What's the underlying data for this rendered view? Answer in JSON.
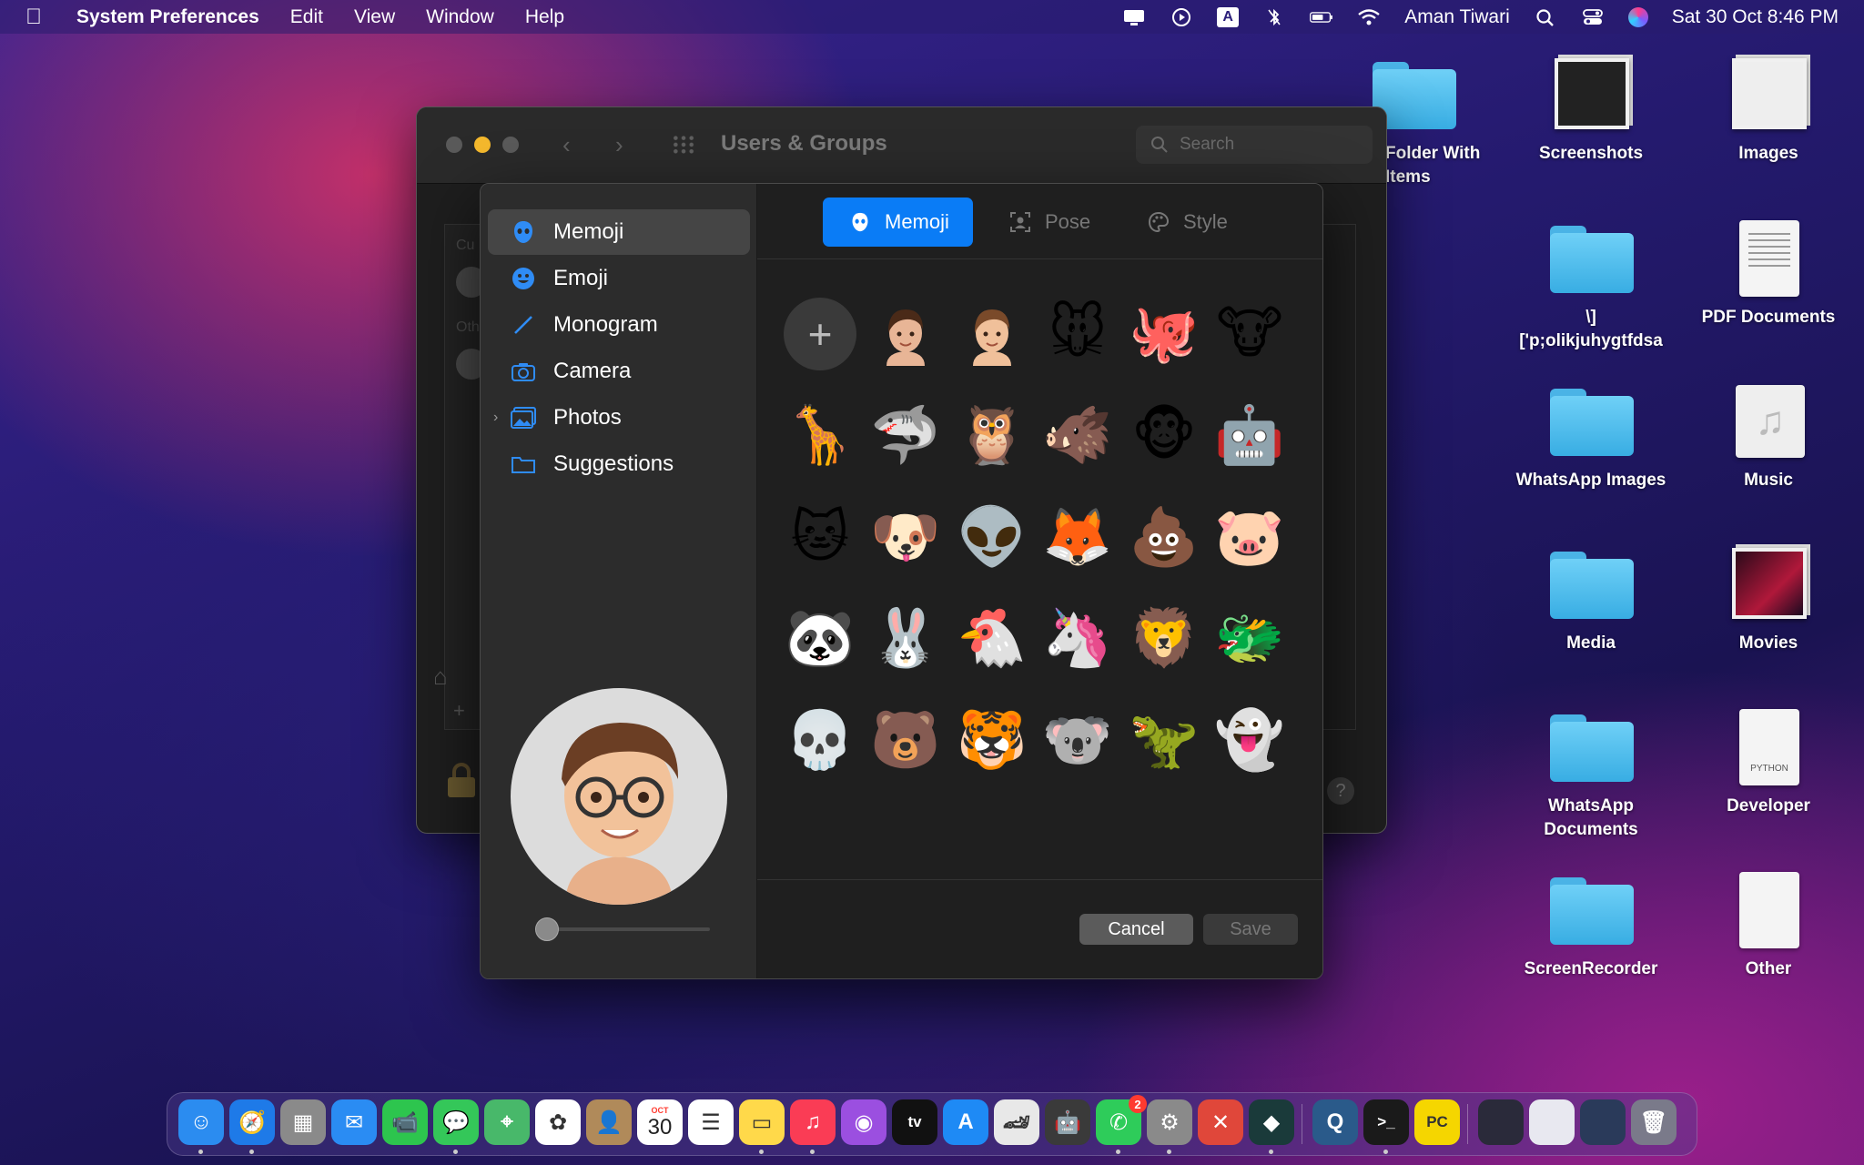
{
  "menubar": {
    "app_name": "System Preferences",
    "menus": [
      "Edit",
      "View",
      "Window",
      "Help"
    ],
    "user": "Aman Tiwari",
    "datetime": "Sat 30 Oct  8:46 PM",
    "input_source": "A"
  },
  "desktop": {
    "items": [
      {
        "label": "Folder With\nItems",
        "kind": "folder"
      },
      {
        "label": "Screenshots",
        "kind": "stack"
      },
      {
        "label": "Images",
        "kind": "stack-doc"
      },
      {
        "label": "\\]\n['p;olikjuhygtfdsa",
        "kind": "folder"
      },
      {
        "label": "PDF Documents",
        "kind": "doc"
      },
      {
        "label": "WhatsApp Images",
        "kind": "folder"
      },
      {
        "label": "Music",
        "kind": "music"
      },
      {
        "label": "Media",
        "kind": "folder"
      },
      {
        "label": "Movies",
        "kind": "stack-movies"
      },
      {
        "label": "WhatsApp\nDocuments",
        "kind": "folder"
      },
      {
        "label": "Developer",
        "kind": "doc-python"
      },
      {
        "label": "ScreenRecorder",
        "kind": "folder"
      },
      {
        "label": "Other",
        "kind": "doc-blank"
      }
    ],
    "python_label": "PYTHON"
  },
  "window": {
    "title": "Users & Groups",
    "search_placeholder": "Search",
    "list_labels": [
      "Cu",
      "Oth"
    ]
  },
  "sheet": {
    "sidebar": [
      {
        "label": "Memoji",
        "icon": "memoji-icon",
        "selected": true
      },
      {
        "label": "Emoji",
        "icon": "emoji-icon",
        "selected": false
      },
      {
        "label": "Monogram",
        "icon": "pencil-icon",
        "selected": false
      },
      {
        "label": "Camera",
        "icon": "camera-icon",
        "selected": false
      },
      {
        "label": "Photos",
        "icon": "photos-icon",
        "selected": false
      },
      {
        "label": "Suggestions",
        "icon": "folder-icon",
        "selected": false
      }
    ],
    "tabs": [
      {
        "label": "Memoji",
        "active": true
      },
      {
        "label": "Pose",
        "active": false
      },
      {
        "label": "Style",
        "active": false
      }
    ],
    "grid": [
      "+",
      "memoji-woman",
      "memoji-man",
      "🐭",
      "🐙",
      "🐮",
      "🦒",
      "🦈",
      "🦉",
      "🐗",
      "🐵",
      "🤖",
      "🐱",
      "🐶",
      "👽",
      "🦊",
      "💩",
      "🐷",
      "🐼",
      "🐰",
      "🐔",
      "🦄",
      "🦁",
      "🐲",
      "💀",
      "🐻",
      "🐯",
      "🐨",
      "🦖",
      "👻"
    ],
    "zoom_level": 0.0,
    "cancel_label": "Cancel",
    "save_label": "Save"
  },
  "dock": {
    "apps": [
      {
        "name": "Finder",
        "color": "#2b8cf0",
        "glyph": "☺",
        "running": true
      },
      {
        "name": "Safari",
        "color": "#1e7ae8",
        "glyph": "🧭",
        "running": true
      },
      {
        "name": "Launchpad",
        "color": "#8a8a8a",
        "glyph": "▦",
        "running": false
      },
      {
        "name": "Mail",
        "color": "#2a8cf3",
        "glyph": "✉",
        "running": false
      },
      {
        "name": "FaceTime",
        "color": "#2dc54e",
        "glyph": "📹",
        "running": false
      },
      {
        "name": "Messages",
        "color": "#34c759",
        "glyph": "💬",
        "running": true
      },
      {
        "name": "Maps",
        "color": "#48b86a",
        "glyph": "⌖",
        "running": false
      },
      {
        "name": "Photos",
        "color": "#ffffff",
        "glyph": "✿",
        "running": false
      },
      {
        "name": "Contacts",
        "color": "#b08a5a",
        "glyph": "👤",
        "running": false
      },
      {
        "name": "Calendar",
        "color": "#ffffff",
        "glyph": "30",
        "running": false
      },
      {
        "name": "Reminders",
        "color": "#ffffff",
        "glyph": "☰",
        "running": false
      },
      {
        "name": "Notes",
        "color": "#ffd94a",
        "glyph": "▭",
        "running": true
      },
      {
        "name": "Music",
        "color": "#fa3c55",
        "glyph": "♫",
        "running": true
      },
      {
        "name": "Podcasts",
        "color": "#9b4fe0",
        "glyph": "◉",
        "running": false
      },
      {
        "name": "TV",
        "color": "#111111",
        "glyph": "tv",
        "running": false
      },
      {
        "name": "App Store",
        "color": "#1e8af5",
        "glyph": "A",
        "running": false
      },
      {
        "name": "Asphalt",
        "color": "#e8e8e8",
        "glyph": "🏎",
        "running": false
      },
      {
        "name": "Android",
        "color": "#3a3a3a",
        "glyph": "🤖",
        "running": false
      },
      {
        "name": "WhatsApp",
        "color": "#2ecc5a",
        "glyph": "✆",
        "running": true,
        "badge": "2"
      },
      {
        "name": "System Preferences",
        "color": "#8a8a8a",
        "glyph": "⚙",
        "running": true
      },
      {
        "name": "Remote",
        "color": "#e0473a",
        "glyph": "✕",
        "running": false
      },
      {
        "name": "Wondershare",
        "color": "#1a3a3a",
        "glyph": "◆",
        "running": true
      },
      {
        "name": "QuickTime",
        "color": "#2a5a8a",
        "glyph": "Q",
        "running": false
      },
      {
        "name": "Terminal",
        "color": "#1a1a1a",
        "glyph": ">_",
        "running": true
      },
      {
        "name": "PyCharm",
        "color": "#f5d600",
        "glyph": "PC",
        "running": false
      },
      {
        "name": "Window 1",
        "color": "#2a2a3a",
        "glyph": "",
        "running": false
      },
      {
        "name": "Window 2",
        "color": "#e8e8f0",
        "glyph": "",
        "running": false
      },
      {
        "name": "Window 3",
        "color": "#2a3a5a",
        "glyph": "",
        "running": false
      },
      {
        "name": "Trash",
        "color": "#7a7a8a",
        "glyph": "🗑",
        "running": false
      }
    ],
    "calendar_month": "OCT"
  }
}
